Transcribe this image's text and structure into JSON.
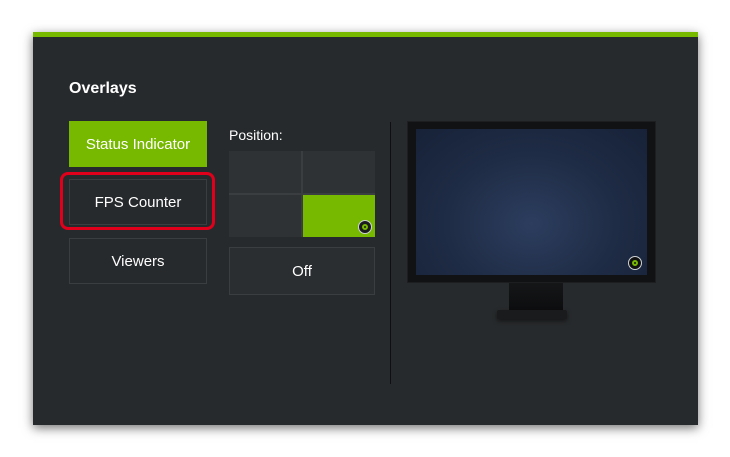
{
  "panel": {
    "title": "Overlays",
    "accent_color": "#76b900",
    "background_color": "#272a2c"
  },
  "overlays_menu": {
    "items": [
      {
        "label": "Status Indicator",
        "active": true
      },
      {
        "label": "FPS Counter",
        "active": false,
        "highlighted": true
      },
      {
        "label": "Viewers",
        "active": false
      }
    ]
  },
  "position": {
    "label": "Position:",
    "grid": [
      "top-left",
      "top-right",
      "bottom-left",
      "bottom-right"
    ],
    "selected": "bottom-right",
    "selected_icon": "status-indicator-icon",
    "off_label": "Off"
  },
  "preview": {
    "icon": "status-indicator-icon",
    "icon_position": "bottom-right"
  }
}
